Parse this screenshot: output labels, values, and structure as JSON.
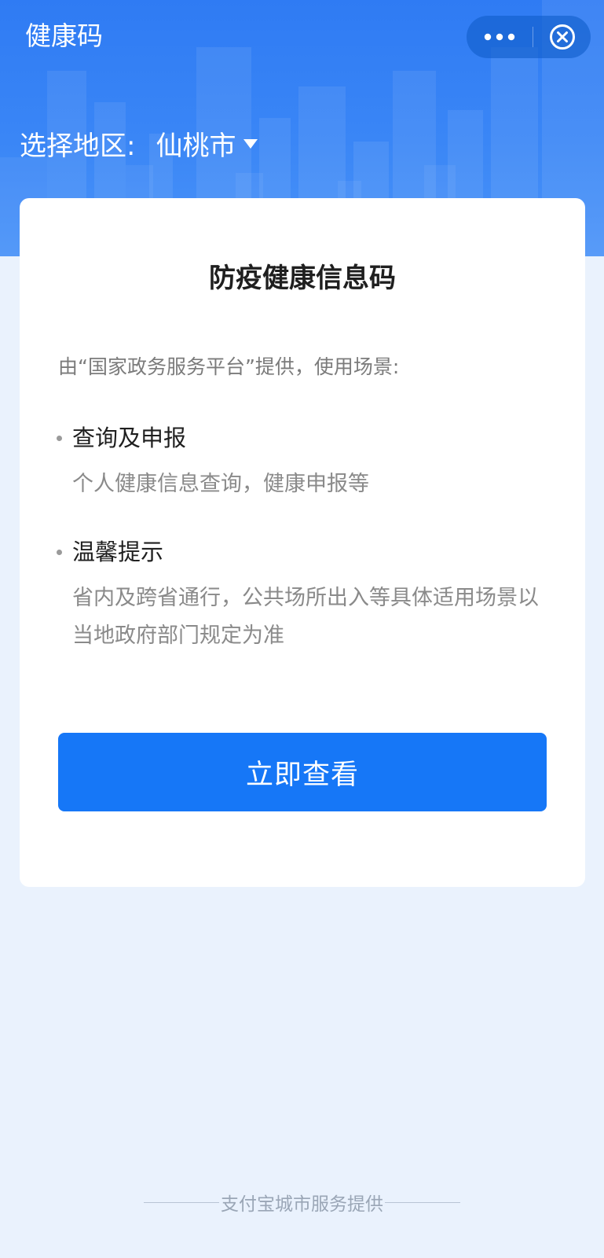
{
  "header": {
    "title": "健康码",
    "more_icon": "more-dots-icon",
    "close_icon": "close-circle-icon"
  },
  "region": {
    "label": "选择地区:",
    "value": "仙桃市",
    "caret_icon": "caret-down-icon"
  },
  "card": {
    "title": "防疫健康信息码",
    "provider": "由“国家政务服务平台”提供，使用场景:",
    "sections": [
      {
        "heading": "查询及申报",
        "desc": "个人健康信息查询，健康申报等"
      },
      {
        "heading": "温馨提示",
        "desc": "省内及跨省通行，公共场所出入等具体适用场景以当地政府部门规定为准"
      }
    ],
    "button_label": "立即查看"
  },
  "footer": {
    "text": "支付宝城市服务提供"
  },
  "colors": {
    "header_blue": "#2f7bf3",
    "primary_button": "#1677f7",
    "page_background": "#eaf2fd"
  }
}
